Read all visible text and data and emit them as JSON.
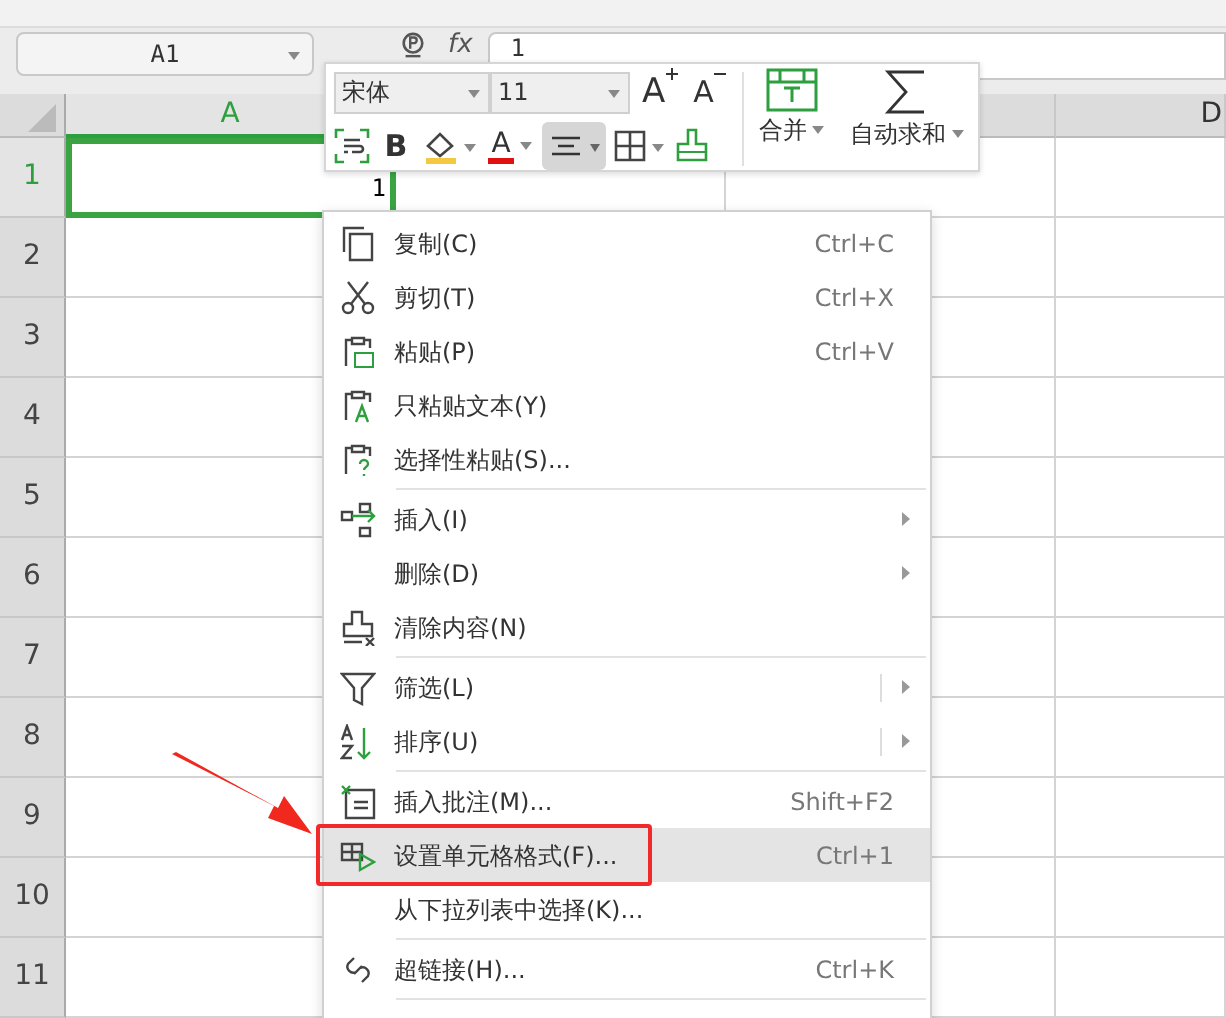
{
  "name_box": {
    "value": "A1"
  },
  "formula_bar": {
    "fx_label": "fx",
    "value": "1"
  },
  "column_headers": [
    {
      "label": "A",
      "selected": true
    },
    {
      "label": "D",
      "selected": false
    }
  ],
  "rows": [
    {
      "label": "1",
      "selected": true
    },
    {
      "label": "2",
      "selected": false
    },
    {
      "label": "3",
      "selected": false
    },
    {
      "label": "4",
      "selected": false
    },
    {
      "label": "5",
      "selected": false
    },
    {
      "label": "6",
      "selected": false
    },
    {
      "label": "7",
      "selected": false
    },
    {
      "label": "8",
      "selected": false
    },
    {
      "label": "9",
      "selected": false
    },
    {
      "label": "10",
      "selected": false
    },
    {
      "label": "11",
      "selected": false
    }
  ],
  "active_cell": {
    "value": "1"
  },
  "mini_toolbar": {
    "font": "宋体",
    "size": "11",
    "grow_label": "A",
    "shrink_label": "A",
    "bold_label": "B",
    "font_color_label": "A",
    "align_active": true,
    "merge": "合并",
    "autosum": "自动求和"
  },
  "context_menu": {
    "items": [
      {
        "kind": "item",
        "label": "复制(C)",
        "shortcut": "Ctrl+C",
        "submenu": false,
        "highlighted": false
      },
      {
        "kind": "item",
        "label": "剪切(T)",
        "shortcut": "Ctrl+X",
        "submenu": false,
        "highlighted": false
      },
      {
        "kind": "item",
        "label": "粘贴(P)",
        "shortcut": "Ctrl+V",
        "submenu": false,
        "highlighted": false
      },
      {
        "kind": "item",
        "label": "只粘贴文本(Y)",
        "submenu": false,
        "highlighted": false
      },
      {
        "kind": "item",
        "label": "选择性粘贴(S)...",
        "submenu": false,
        "highlighted": false
      },
      {
        "kind": "separator"
      },
      {
        "kind": "item",
        "label": "插入(I)",
        "submenu": true,
        "split": false,
        "highlighted": false
      },
      {
        "kind": "item",
        "label": "删除(D)",
        "submenu": true,
        "split": false,
        "highlighted": false
      },
      {
        "kind": "item",
        "label": "清除内容(N)",
        "submenu": false,
        "highlighted": false
      },
      {
        "kind": "separator"
      },
      {
        "kind": "item",
        "label": "筛选(L)",
        "submenu": true,
        "split": true,
        "highlighted": false
      },
      {
        "kind": "item",
        "label": "排序(U)",
        "submenu": true,
        "split": true,
        "highlighted": false
      },
      {
        "kind": "separator"
      },
      {
        "kind": "item",
        "label": "插入批注(M)...",
        "shortcut": "Shift+F2",
        "submenu": false,
        "highlighted": false
      },
      {
        "kind": "item",
        "label": "设置单元格格式(F)...",
        "shortcut": "Ctrl+1",
        "submenu": false,
        "highlighted": true,
        "annotated": true
      },
      {
        "kind": "item",
        "label": "从下拉列表中选择(K)...",
        "submenu": false,
        "highlighted": false
      },
      {
        "kind": "separator"
      },
      {
        "kind": "item",
        "label": "超链接(H)...",
        "shortcut": "Ctrl+K",
        "submenu": false,
        "highlighted": false
      },
      {
        "kind": "separator"
      }
    ]
  }
}
